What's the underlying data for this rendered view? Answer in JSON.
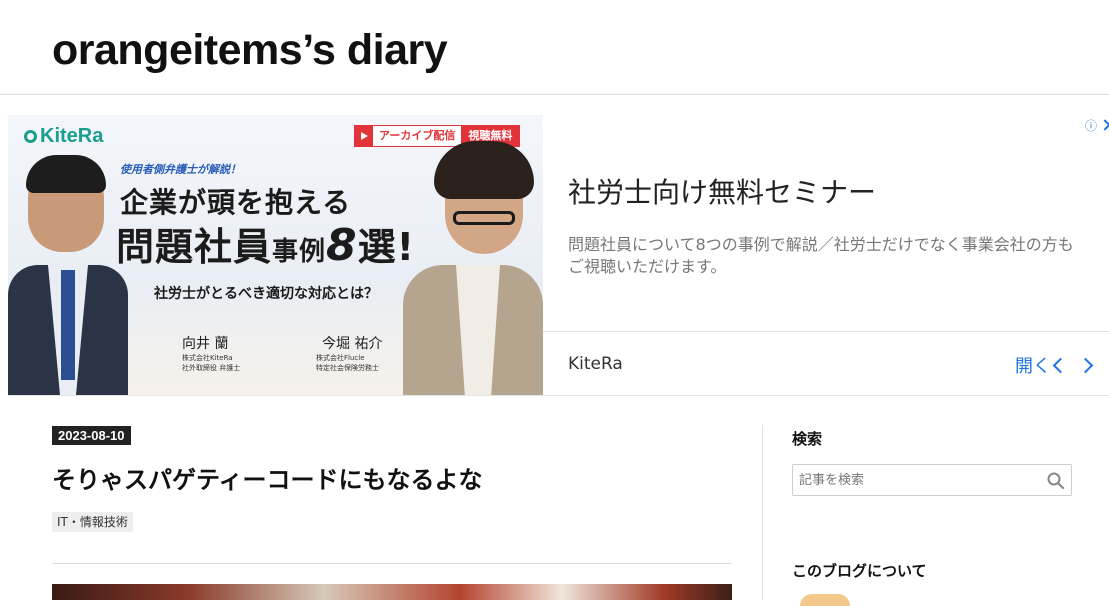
{
  "blog": {
    "title": "orangeitems’s diary"
  },
  "ad": {
    "image": {
      "logo": "KiteRa",
      "archive_label": "アーカイブ配信",
      "free_label": "視聴無料",
      "subheading": "使用者側弁護士が解説！",
      "headline_line1": "企業が頭を抱える",
      "headline_line2_main": "問題社員",
      "headline_line2_small": "事例",
      "headline_line2_num": "8",
      "headline_line2_end": "選!",
      "headline_line3": "社労士がとるべき適切な対応とは？",
      "speaker1_name": "向井 蘭",
      "speaker1_sub": "株式会社KiteRa\n社外取締役 弁護士",
      "speaker2_name": "今堀 祐介",
      "speaker2_sub": "株式会社Flucle\n特定社会保険労務士"
    },
    "title": "社労士向け無料セミナー",
    "description": "問題社員について8つの事例で解説／社労士だけでなく事業会社の方もご視聴いただけます。",
    "advertiser": "KiteRa",
    "open_label": "開く",
    "choices_icon": "ⓘ",
    "colors": {
      "accent": "#1a73e8",
      "logo": "#1a9e8f",
      "archive": "#e2333a"
    }
  },
  "entry": {
    "date": "2023-08-10",
    "title": "そりゃスパゲティーコードにもなるよな",
    "category": "IT・情報技術"
  },
  "sidebar": {
    "search": {
      "heading": "検索",
      "placeholder": "記事を検索"
    },
    "about": {
      "heading": "このブログについて"
    }
  }
}
